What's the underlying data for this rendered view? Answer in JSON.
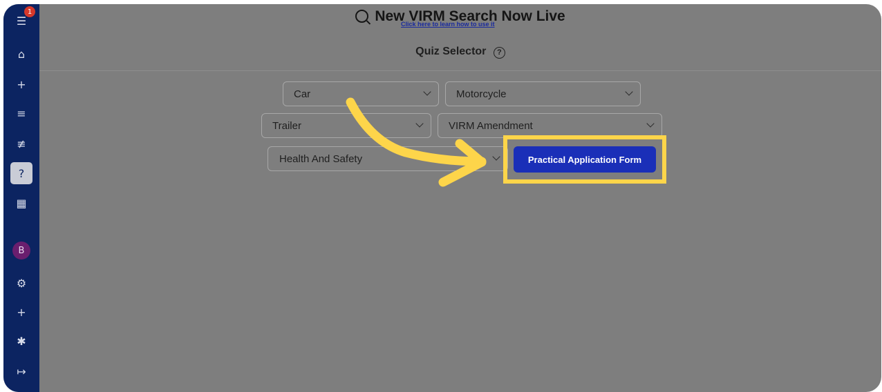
{
  "sidebar": {
    "notification_count": "1",
    "avatar_initial": "B",
    "items": [
      {
        "name": "menu-icon",
        "glyph": "☰"
      },
      {
        "name": "home-icon",
        "glyph": "⌂"
      },
      {
        "name": "add-icon",
        "glyph": "+"
      },
      {
        "name": "list-icon",
        "glyph": "≡"
      },
      {
        "name": "edit-list-icon",
        "glyph": "≢"
      },
      {
        "name": "quiz-icon",
        "glyph": "?"
      },
      {
        "name": "calculator-icon",
        "glyph": "▦"
      },
      {
        "name": "settings-icon",
        "glyph": "⚙"
      },
      {
        "name": "add-user-icon",
        "glyph": "+"
      },
      {
        "name": "bug-icon",
        "glyph": "✱"
      },
      {
        "name": "logout-icon",
        "glyph": "↦"
      }
    ]
  },
  "banner": {
    "title": "New VIRM Search Now Live",
    "link": "Click here to learn how to use it"
  },
  "quiz_selector": {
    "title": "Quiz Selector",
    "help_glyph": "?"
  },
  "selects": {
    "car": "Car",
    "motorcycle": "Motorcycle",
    "trailer": "Trailer",
    "virm_amendment": "VIRM Amendment",
    "health_and_safety": "Health And Safety"
  },
  "action": {
    "practical_application_form": "Practical Application Form"
  },
  "colors": {
    "sidebar": "#0c2461",
    "overlay": "#7e7e7e",
    "highlight": "#fdd54a",
    "button": "#1a2fb8",
    "arrow": "#fdd54a"
  }
}
